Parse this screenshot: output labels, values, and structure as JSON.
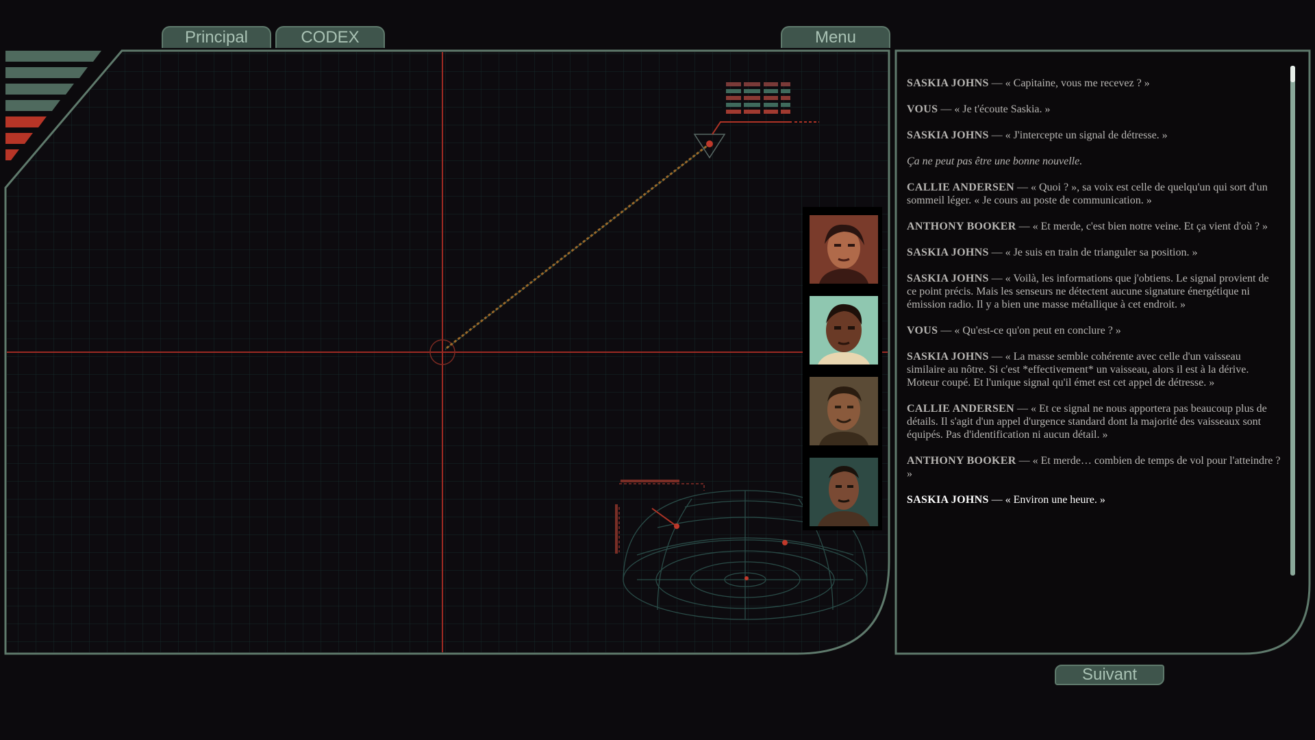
{
  "nav": {
    "principal_label": "Principal",
    "codex_label": "CODEX",
    "menu_label": "Menu"
  },
  "dialogue": [
    {
      "speaker": "SASKIA JOHNS",
      "text": " — « Capitaine, vous me recevez ? »"
    },
    {
      "speaker": "VOUS",
      "text": " — « Je t'écoute Saskia. »"
    },
    {
      "speaker": "SASKIA JOHNS",
      "text": " — « J'intercepte un signal de détresse. »"
    },
    {
      "speaker": "",
      "text": "Ça ne peut pas être une bonne nouvelle.",
      "narration": true
    },
    {
      "speaker": "CALLIE ANDERSEN",
      "text": " — « Quoi ? », sa voix est celle de quelqu'un qui sort d'un sommeil léger. « Je cours au poste de communication. »"
    },
    {
      "speaker": "ANTHONY BOOKER",
      "text": " — « Et merde, c'est bien notre veine. Et ça vient d'où ? »"
    },
    {
      "speaker": "SASKIA JOHNS",
      "text": " — « Je suis en train de trianguler sa position. »"
    },
    {
      "speaker": "SASKIA JOHNS",
      "text": " — « Voilà, les informations que j'obtiens. Le signal provient de ce point précis. Mais les senseurs ne détectent aucune signature énergétique ni émission radio. Il y a bien une masse métallique à cet endroit. »"
    },
    {
      "speaker": "VOUS",
      "text": " — « Qu'est-ce qu'on peut en conclure ? »"
    },
    {
      "speaker": "SASKIA JOHNS",
      "text": " — « La masse semble cohérente avec celle d'un vaisseau similaire au nôtre. Si c'est *effectivement* un vaisseau, alors il est à la dérive. Moteur coupé. Et l'unique signal qu'il émet est cet appel de détresse. »"
    },
    {
      "speaker": "CALLIE ANDERSEN",
      "text": " — « Et ce signal ne nous apportera pas beaucoup plus de détails. Il s'agit d'un appel d'urgence standard dont la majorité des vaisseaux sont équipés. Pas d'identification ni aucun détail. »"
    },
    {
      "speaker": "ANTHONY BOOKER",
      "text": " — « Et merde… combien de temps de vol pour l'atteindre ? »"
    },
    {
      "speaker": "SASKIA JOHNS",
      "text": " — « Environ une heure. »",
      "current": true
    }
  ],
  "next_label": "Suivant",
  "portraits": [
    {
      "icon": "crew-portrait-woman-icon",
      "bg": "#7a3b2b"
    },
    {
      "icon": "crew-portrait-woman-icon",
      "bg": "#8fc7b0"
    },
    {
      "icon": "crew-portrait-man-icon",
      "bg": "#5b4b36"
    },
    {
      "icon": "crew-portrait-man-icon",
      "bg": "#2e4a44"
    }
  ],
  "colors": {
    "accent_green": "#5f7a6c",
    "accent_red": "#c0392b",
    "text": "#b8b6b3"
  }
}
